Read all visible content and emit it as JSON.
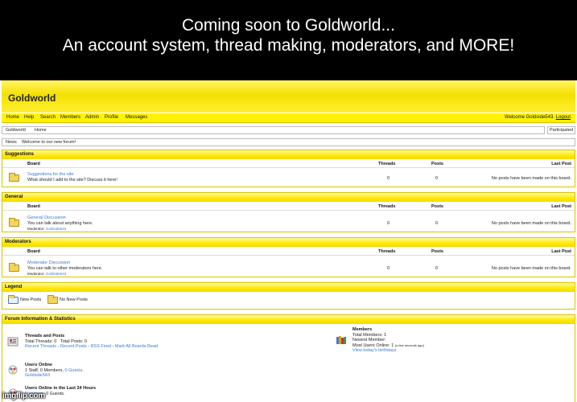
{
  "caption": {
    "line1": "Coming soon to Goldworld...",
    "line2": "An account system, thread making, moderators, and MORE!"
  },
  "forum": {
    "logo": "Goldworld",
    "menu": [
      "Home",
      "Help",
      "Search",
      "Members",
      "Admin",
      "Profile",
      "Messages"
    ],
    "welcome_prefix": "Welcome Goldside543.",
    "logout": "Logout",
    "breadcrumb": {
      "site": "Goldworld",
      "page": "Home"
    },
    "participated_button": "Participated",
    "news": {
      "label": "News",
      "text": "Welcome to our new forum!"
    },
    "columns": {
      "board": "Board",
      "threads": "Threads",
      "posts": "Posts",
      "last_post": "Last Post"
    },
    "categories": [
      {
        "title": "Suggestions",
        "board": "Suggestions for the site",
        "description": "What should I add to the site? Discuss it here!",
        "moderators_label": "",
        "moderator": "",
        "threads": "0",
        "posts": "0",
        "last_post": "No posts have been made on this board."
      },
      {
        "title": "General",
        "board": "General Discussion",
        "description": "You can talk about anything here.",
        "moderators_label": "Moderator:",
        "moderator": "Goldside543",
        "threads": "0",
        "posts": "0",
        "last_post": "No posts have been made on this board."
      },
      {
        "title": "Moderators",
        "board": "Moderator Discussion",
        "description": "You can talk to other moderators here.",
        "moderators_label": "Moderator:",
        "moderator": "Goldside543",
        "threads": "0",
        "posts": "0",
        "last_post": "No posts have been made on this board."
      }
    ],
    "legend": {
      "title": "Legend",
      "new_posts": "New Posts",
      "no_new_posts": "No New Posts"
    },
    "stats": {
      "title": "Forum Information & Statistics",
      "threads_and_posts": {
        "title": "Threads and Posts",
        "total_threads": "Total Threads: 0",
        "total_posts": "Total Posts: 0",
        "links": [
          "Recent Threads",
          "Recent Posts",
          "RSS Feed",
          "Mark All Boards Read"
        ],
        "separator": "-"
      },
      "members": {
        "title": "Members",
        "total": "Total Members: 1",
        "newest": "Newest Member:",
        "most_online": "Most Users Online: 1",
        "most_online_note": "(a few seconds ago)",
        "birthdays": "View today's birthdays"
      },
      "users_online": {
        "title": "Users Online",
        "summary_prefix": "1 Staff, 0 Members,",
        "guests": "0 Guests.",
        "user": "Goldside543"
      },
      "last24": {
        "title": "Users Online in the Last 24 Hours",
        "members_link": "Members",
        "guests": ", 0 Guests."
      }
    }
  },
  "watermark": "imgflip.com"
}
